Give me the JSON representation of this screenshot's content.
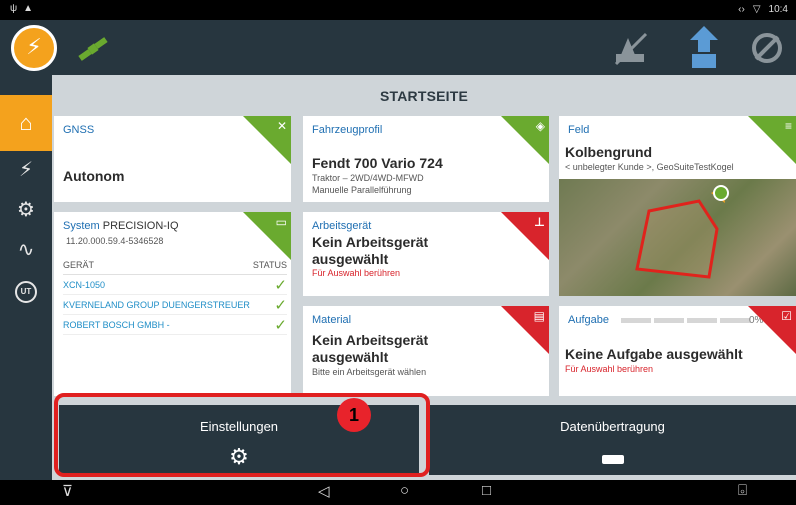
{
  "statusbar": {
    "time": "10:4",
    "left_icons": [
      "usb-icon",
      "notification-icon"
    ],
    "right_icons": [
      "sync-icon",
      "wifi-icon"
    ]
  },
  "appbar": {
    "right_icons": [
      "implement-off-icon",
      "autosteer-icon",
      "disabled-icon"
    ]
  },
  "sidebar": {
    "items": [
      "home-icon",
      "guidance-icon",
      "implement-icon",
      "diagnostics-icon",
      "ut-icon"
    ],
    "ut_label": "UT"
  },
  "page": {
    "title": "STARTSEITE"
  },
  "gnss": {
    "header": "GNSS",
    "value": "Autonom"
  },
  "vehicle": {
    "header": "Fahrzeugprofil",
    "name": "Fendt 700 Vario 724",
    "type": "Traktor – 2WD/4WD-MFWD",
    "mode": "Manuelle Parallelführung"
  },
  "field": {
    "header": "Feld",
    "name": "Kolbengrund",
    "customer": "< unbelegter Kunde >, GeoSuiteTestKogel"
  },
  "system": {
    "header": "System",
    "product": "PRECISION-IQ",
    "version": "11.20.000.59.4-5346528",
    "col_device": "GERÄT",
    "col_status": "STATUS",
    "devices": [
      "XCN-1050",
      "KVERNELAND GROUP DUENGERSTREUER",
      "ROBERT BOSCH GMBH -"
    ]
  },
  "implement": {
    "header": "Arbeitsgerät",
    "value": "Kein Arbeitsgerät ausgewählt",
    "hint": "Für Auswahl berühren"
  },
  "material": {
    "header": "Material",
    "value": "Kein Arbeitsgerät ausgewählt",
    "hint": "Bitte ein Arbeitsgerät wählen"
  },
  "task": {
    "header": "Aufgabe",
    "progress": "0%",
    "value": "Keine Aufgabe ausgewählt",
    "hint": "Für Auswahl berühren"
  },
  "buttons": {
    "settings": "Einstellungen",
    "transfer": "Datenübertragung"
  },
  "annotation": {
    "number": "1",
    "color": "#e02020"
  },
  "colors": {
    "accent": "#f4a21d",
    "header_bar": "#27363f",
    "ok_green": "#6aaa2f",
    "alert_red": "#d8242c",
    "link_blue": "#1f6fb2"
  }
}
